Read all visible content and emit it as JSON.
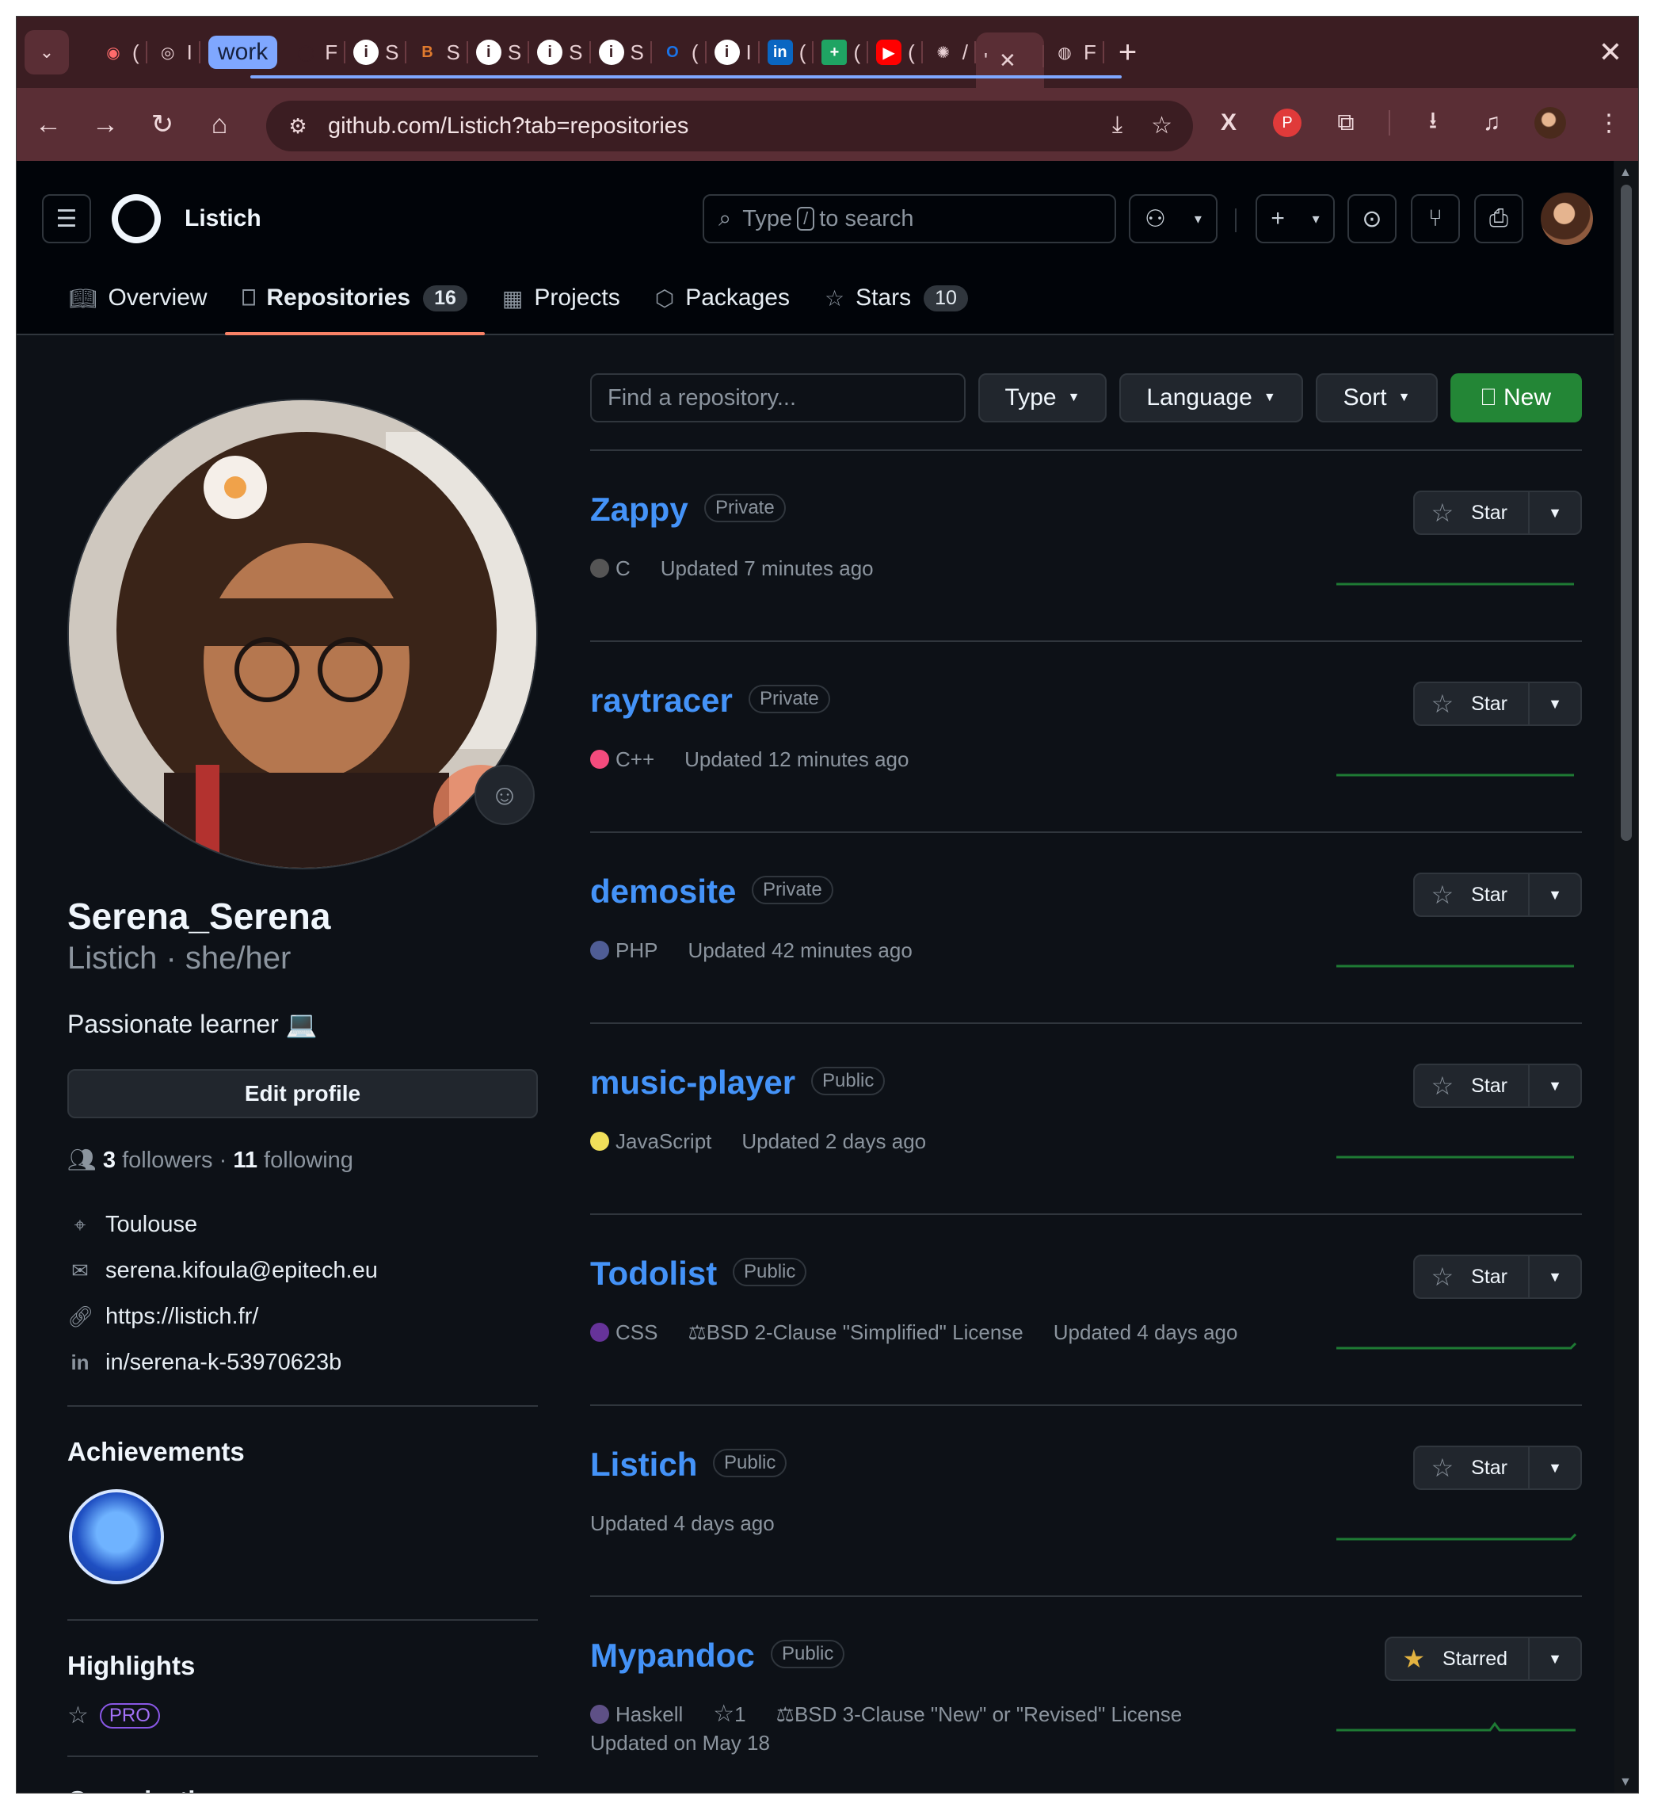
{
  "browser": {
    "tab_group_label": "work",
    "url": "github.com/Listich?tab=repositories",
    "tabs": [
      {
        "label": "(",
        "icon": "record-icon"
      },
      {
        "label": "I",
        "icon": "chrome-icon"
      },
      {
        "label": "F",
        "icon": "github-icon"
      },
      {
        "label": "S",
        "icon": "info-icon"
      },
      {
        "label": "S",
        "icon": "b-icon"
      },
      {
        "label": "S",
        "icon": "info-icon"
      },
      {
        "label": "S",
        "icon": "info-icon"
      },
      {
        "label": "S",
        "icon": "info-icon"
      },
      {
        "label": "(",
        "icon": "outlook-icon"
      },
      {
        "label": "I",
        "icon": "info-icon"
      },
      {
        "label": "(",
        "icon": "linkedin-icon"
      },
      {
        "label": "(",
        "icon": "sheets-icon"
      },
      {
        "label": "(",
        "icon": "youtube-icon"
      },
      {
        "label": "/",
        "icon": "openai-icon"
      },
      {
        "label": "'",
        "icon": "active-tab"
      },
      {
        "label": "F",
        "icon": "globe-icon"
      }
    ]
  },
  "header": {
    "owner": "Listich",
    "search_placeholder_before": "Type",
    "search_slash": "/",
    "search_placeholder_after": "to search"
  },
  "nav": [
    {
      "label": "Overview",
      "icon": "book-icon",
      "count": null
    },
    {
      "label": "Repositories",
      "icon": "repo-icon",
      "count": "16"
    },
    {
      "label": "Projects",
      "icon": "table-icon",
      "count": null
    },
    {
      "label": "Packages",
      "icon": "package-icon",
      "count": null
    },
    {
      "label": "Stars",
      "icon": "star-icon",
      "count": "10"
    }
  ],
  "profile": {
    "display_name": "Serena_Serena",
    "handle_line": "Listich · she/her",
    "bio": "Passionate learner 💻",
    "edit_label": "Edit profile",
    "followers_count": "3",
    "followers_label": "followers",
    "following_count": "11",
    "following_label": "following",
    "location": "Toulouse",
    "email": "serena.kifoula@epitech.eu",
    "website": "https://listich.fr/",
    "linkedin": "in/serena-k-53970623b",
    "achievements_title": "Achievements",
    "highlights_title": "Highlights",
    "pro_label": "PRO",
    "organizations_title": "Organizations"
  },
  "toolbar": {
    "find_placeholder": "Find a repository...",
    "type_label": "Type",
    "language_label": "Language",
    "sort_label": "Sort",
    "new_label": "New"
  },
  "repos": [
    {
      "name": "Zappy",
      "visibility": "Private",
      "language": "C",
      "lang_color": "#555555",
      "license": "",
      "stars": "",
      "updated": "Updated 7 minutes ago",
      "star_label": "Star",
      "starred": false
    },
    {
      "name": "raytracer",
      "visibility": "Private",
      "language": "C++",
      "lang_color": "#f34b7d",
      "license": "",
      "stars": "",
      "updated": "Updated 12 minutes ago",
      "star_label": "Star",
      "starred": false
    },
    {
      "name": "demosite",
      "visibility": "Private",
      "language": "PHP",
      "lang_color": "#4F5D95",
      "license": "",
      "stars": "",
      "updated": "Updated 42 minutes ago",
      "star_label": "Star",
      "starred": false
    },
    {
      "name": "music-player",
      "visibility": "Public",
      "language": "JavaScript",
      "lang_color": "#f1e05a",
      "license": "",
      "stars": "",
      "updated": "Updated 2 days ago",
      "star_label": "Star",
      "starred": false
    },
    {
      "name": "Todolist",
      "visibility": "Public",
      "language": "CSS",
      "lang_color": "#663399",
      "license": "BSD 2-Clause \"Simplified\" License",
      "stars": "",
      "updated": "Updated 4 days ago",
      "star_label": "Star",
      "starred": false
    },
    {
      "name": "Listich",
      "visibility": "Public",
      "language": "",
      "lang_color": "",
      "license": "",
      "stars": "",
      "updated": "Updated 4 days ago",
      "star_label": "Star",
      "starred": false
    },
    {
      "name": "Mypandoc",
      "visibility": "Public",
      "language": "Haskell",
      "lang_color": "#5e5086",
      "license": "BSD 3-Clause \"New\" or \"Revised\" License",
      "stars": "1",
      "updated": "Updated on May 18",
      "star_label": "Starred",
      "starred": true
    }
  ],
  "colors": {
    "accent_green": "#238636",
    "link_blue": "#4493f8",
    "tab_underline": "#f78166",
    "browser_frame": "#5a2e35"
  }
}
